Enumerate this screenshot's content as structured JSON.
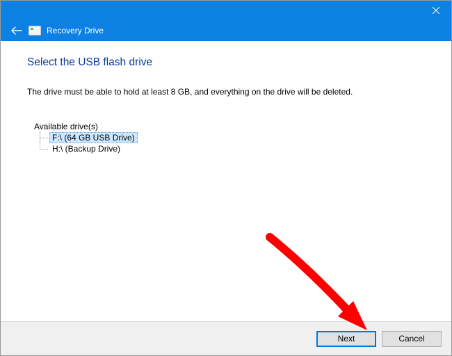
{
  "titlebar": {
    "close_label": "Close"
  },
  "subheader": {
    "app_title": "Recovery Drive"
  },
  "main": {
    "heading": "Select the USB flash drive",
    "description": "The drive must be able to hold at least 8 GB, and everything on the drive will be deleted.",
    "drives_label": "Available drive(s)",
    "drives": [
      {
        "label": "F:\\ (64 GB USB Drive)",
        "selected": true
      },
      {
        "label": "H:\\ (Backup Drive)",
        "selected": false
      }
    ]
  },
  "footer": {
    "next_label": "Next",
    "cancel_label": "Cancel"
  },
  "colors": {
    "accent": "#0d80e4",
    "heading": "#0a39a0",
    "annotation": "#ff0000"
  }
}
